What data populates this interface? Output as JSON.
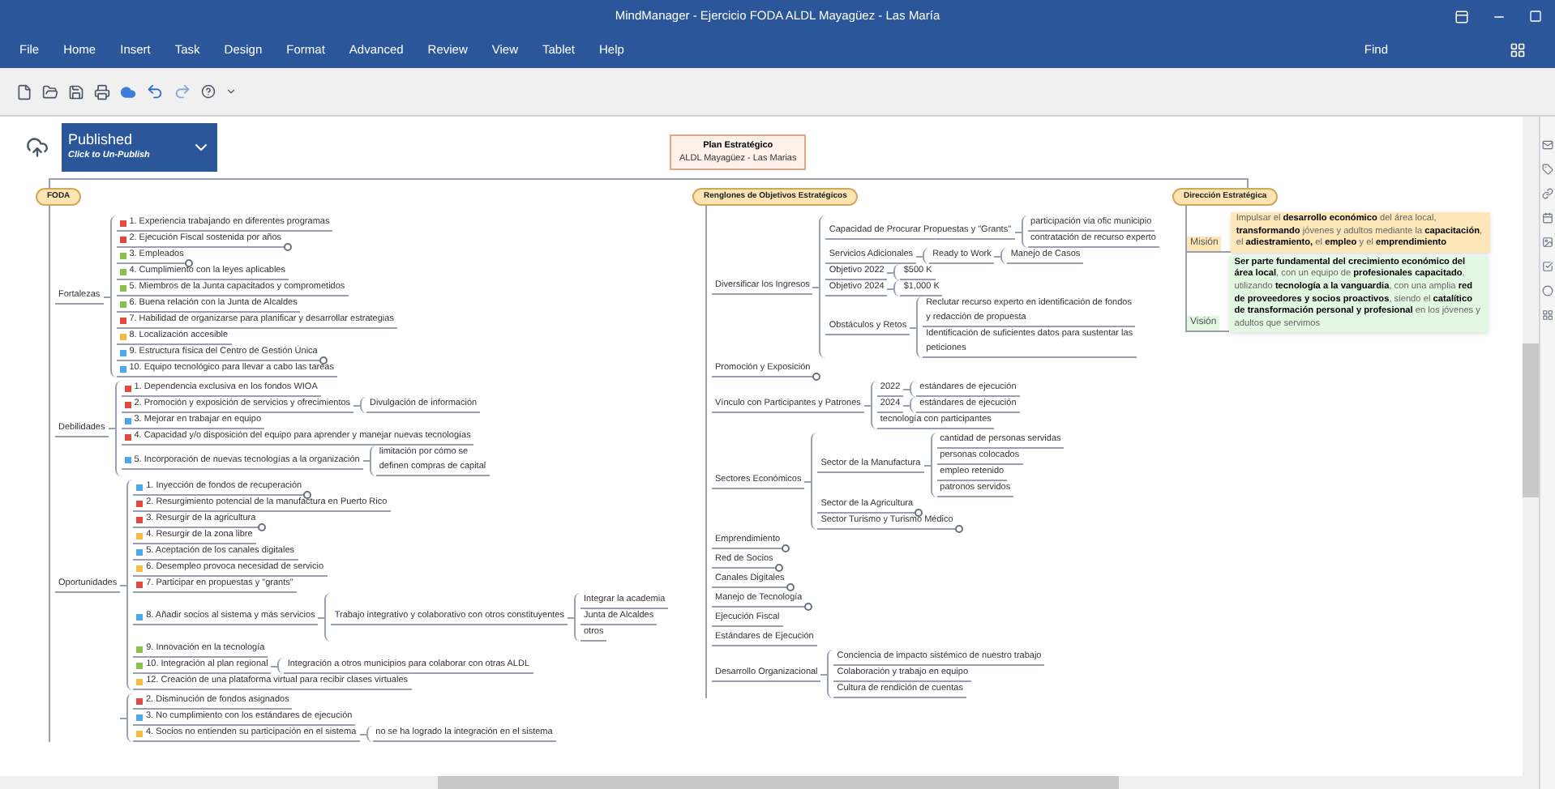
{
  "window": {
    "title": "MindManager - Ejercicio FODA ALDL Mayagüez - Las María"
  },
  "menu": [
    "File",
    "Home",
    "Insert",
    "Task",
    "Design",
    "Format",
    "Advanced",
    "Review",
    "View",
    "Tablet",
    "Help"
  ],
  "find_label": "Find",
  "publish": {
    "status": "Published",
    "action": "Click to Un-Publish"
  },
  "central_topic": {
    "title": "Plan Estratégico",
    "subtitle": "ALDL Mayagüez - Las Marias"
  },
  "main_topics": [
    {
      "kind": "tree",
      "title": "FODA",
      "children": [
        {
          "text": "Fortalezas",
          "collapsed": false,
          "children": [
            {
              "text": "1. Experiencia trabajando en diferentes programas",
              "color": "#e04a3f",
              "collapsed": false
            },
            {
              "text": "2. Ejecución Fiscal sostenida por años",
              "color": "#e04a3f",
              "collapsed": true
            },
            {
              "text": "3. Empleados",
              "color": "#8cc152",
              "collapsed": true
            },
            {
              "text": "4. Cumplimiento con la leyes aplicables",
              "color": "#8cc152",
              "collapsed": false
            },
            {
              "text": "5. Miembros de la Junta capacitados y comprometidos",
              "color": "#8cc152",
              "collapsed": false
            },
            {
              "text": "6. Buena relación con la Junta de Alcaldes",
              "color": "#8cc152",
              "collapsed": false
            },
            {
              "text": "7. Habilidad de organizarse para planificar y desarrollar estrategias",
              "color": "#e04a3f",
              "collapsed": false
            },
            {
              "text": "8. Localización accesible",
              "color": "#f6bb42",
              "collapsed": false
            },
            {
              "text": "9. Estructura física del Centro de Gestión Única",
              "color": "#4fa8e8",
              "collapsed": true
            },
            {
              "text": "10. Equipo tecnológico para llevar a cabo las tareas",
              "color": "#4fa8e8",
              "collapsed": false
            }
          ]
        },
        {
          "text": "Debilidades",
          "collapsed": false,
          "children": [
            {
              "text": "1. Dependencia exclusiva en los fondos WIOA",
              "color": "#e04a3f",
              "collapsed": false
            },
            {
              "text": "2. Promoción y exposición de servicios y ofrecimientos",
              "color": "#e04a3f",
              "collapsed": false,
              "children": [
                {
                  "text": "Divulgación de información",
                  "collapsed": false
                }
              ]
            },
            {
              "text": "3. Mejorar en trabajar en equipo",
              "color": "#4fa8e8",
              "collapsed": false
            },
            {
              "text": "4. Capacidad y/o disposición del equipo para aprender y manejar nuevas tecnologías",
              "color": "#e04a3f",
              "collapsed": false
            },
            {
              "text": "5. Incorporación de nuevas tecnologías a la organización",
              "color": "#4fa8e8",
              "collapsed": false,
              "children": [
                {
                  "text": "limitación por cómo se\ndefinen compras de capital",
                  "collapsed": false
                }
              ]
            }
          ]
        },
        {
          "text": "Oportunidades",
          "collapsed": false,
          "children": [
            {
              "text": "1. Inyección de fondos de recuperación",
              "color": "#4fa8e8",
              "collapsed": true
            },
            {
              "text": "2. Resurgimiento potencial de la manufactura en Puerto Rico",
              "color": "#e04a3f",
              "collapsed": false
            },
            {
              "text": "3. Resurgir de la agricultura",
              "color": "#e04a3f",
              "collapsed": true
            },
            {
              "text": "4. Resurgir de la zona libre",
              "color": "#f6bb42",
              "collapsed": false
            },
            {
              "text": "5. Aceptación de los canales digitales",
              "color": "#4fa8e8",
              "collapsed": false
            },
            {
              "text": "6. Desempleo provoca necesidad de servicio",
              "color": "#f6bb42",
              "collapsed": false
            },
            {
              "text": "7. Participar en propuestas y \"grants\"",
              "color": "#e04a3f",
              "collapsed": false
            },
            {
              "text": "8. Añadir socios al sistema y más servicios",
              "color": "#4fa8e8",
              "collapsed": false,
              "children": [
                {
                  "text": "Trabajo integrativo y colaborativo con otros constituyentes",
                  "collapsed": false,
                  "children": [
                    {
                      "text": "Integrar la academia",
                      "collapsed": false
                    },
                    {
                      "text": "Junta de Alcaldes",
                      "collapsed": false
                    },
                    {
                      "text": "otros",
                      "collapsed": false
                    }
                  ]
                }
              ]
            },
            {
              "text": "9. Innovación en la tecnología",
              "color": "#8cc152",
              "collapsed": false
            },
            {
              "text": "10. Integración al plan regional",
              "color": "#8cc152",
              "collapsed": false,
              "children": [
                {
                  "text": "Integración a otros municipios para colaborar con otras ALDL",
                  "collapsed": false
                }
              ]
            },
            {
              "text": "12. Creación de una plataforma virtual para recibir clases virtuales",
              "color": "#f6bb42",
              "collapsed": false
            }
          ]
        },
        {
          "children": [
            {
              "text": "2. Disminución de fondos asignados",
              "color": "#e04a3f",
              "collapsed": false
            },
            {
              "text": "3. No cumplimiento con los estándares de ejecución",
              "color": "#4fa8e8",
              "collapsed": false
            },
            {
              "text": "4. Socios no entienden su participación en el sistema",
              "color": "#f6bb42",
              "collapsed": false,
              "children": [
                {
                  "text": "no se ha logrado la integración en el sistema",
                  "collapsed": false
                }
              ]
            }
          ]
        }
      ]
    },
    {
      "kind": "tree",
      "title": "Renglones de Objetivos Estratégicos",
      "children": [
        {
          "text": "Diversificar los Ingresos",
          "collapsed": false,
          "children": [
            {
              "text": "Capacidad de Procurar Propuestas y \"Grants\"",
              "collapsed": false,
              "children": [
                {
                  "text": "participación vía ofic municipio",
                  "collapsed": false
                },
                {
                  "text": "contratación de recurso experto",
                  "collapsed": false
                }
              ]
            },
            {
              "text": "Servicios Adicionales",
              "collapsed": false,
              "children": [
                {
                  "text": "Ready to Work",
                  "collapsed": false,
                  "children": [
                    {
                      "text": "Manejo de Casos",
                      "collapsed": false
                    }
                  ]
                }
              ]
            },
            {
              "text": "Objetivo 2022",
              "collapsed": false,
              "children": [
                {
                  "text": "$500 K",
                  "collapsed": false
                }
              ]
            },
            {
              "text": "Objetivo 2024",
              "collapsed": false,
              "children": [
                {
                  "text": "$1,000 K",
                  "collapsed": false
                }
              ]
            },
            {
              "text": "Obstáculos y Retos",
              "collapsed": false,
              "children": [
                {
                  "text": "Reclutar recurso experto en identificación de fondos\ny redacción de propuesta",
                  "collapsed": false
                },
                {
                  "text": "Identificación de suficientes datos para sustentar las\npeticiones",
                  "collapsed": false
                }
              ]
            }
          ]
        },
        {
          "text": "Promoción y Exposición",
          "collapsed": true
        },
        {
          "text": "Vínculo con Participantes y Patrones",
          "collapsed": false,
          "children": [
            {
              "text": "2022",
              "collapsed": false,
              "children": [
                {
                  "text": "estándares de ejecución",
                  "collapsed": false
                }
              ]
            },
            {
              "text": "2024",
              "collapsed": false,
              "children": [
                {
                  "text": "estándares de ejecución",
                  "collapsed": false
                }
              ]
            },
            {
              "text": "tecnología con participantes",
              "collapsed": false
            }
          ]
        },
        {
          "text": "Sectores Económicos",
          "collapsed": false,
          "children": [
            {
              "text": "Sector de la Manufactura",
              "collapsed": false,
              "children": [
                {
                  "text": "cantidad de personas servidas",
                  "collapsed": false
                },
                {
                  "text": "personas colocados",
                  "collapsed": false
                },
                {
                  "text": "empleo retenido",
                  "collapsed": false
                },
                {
                  "text": "patronos servidos",
                  "collapsed": false
                }
              ]
            },
            {
              "text": "Sector de la Agricultura",
              "collapsed": true
            },
            {
              "text": "Sector Turismo y Turismo Médico",
              "collapsed": true
            }
          ]
        },
        {
          "text": "Emprendimiento",
          "collapsed": true
        },
        {
          "text": "Red de Socios",
          "collapsed": true
        },
        {
          "text": "Canales Digitales",
          "collapsed": true
        },
        {
          "text": "Manejo de Tecnología",
          "collapsed": true
        },
        {
          "text": "Ejecución Fiscal",
          "collapsed": false
        },
        {
          "text": "Estándares de Ejecución",
          "collapsed": false
        },
        {
          "text": "Desarrollo Organizacional",
          "collapsed": false,
          "children": [
            {
              "text": "Conciencia de impacto sistémico de nuestro trabajo",
              "collapsed": false
            },
            {
              "text": "Colaboración y trabajo en equipo",
              "collapsed": false
            },
            {
              "text": "Cultura de rendición de cuentas",
              "collapsed": false
            }
          ]
        }
      ]
    },
    {
      "kind": "notes",
      "title": "Dirección Estratégica",
      "children": [
        {
          "text": "Misión",
          "color": "#fde6b8",
          "note": "Impulsar el **desarrollo económico** del área local, **transformando** jóvenes y adultos mediante la **capacitación**, el **adiestramiento,** el **empleo** y el **emprendimiento**"
        },
        {
          "text": "Visión",
          "color": "#e3f8e3",
          "note": "**Ser parte fundamental del crecimiento económico del área local**, con un equipo de **profesionales capacitado**, utilizando **tecnología a la vanguardia**, con una amplia **red de proveedores y socios proactivos**, siendo el **catalítico de transformación personal y profesional** en los jóvenes y adultos que servimos"
        }
      ]
    }
  ]
}
